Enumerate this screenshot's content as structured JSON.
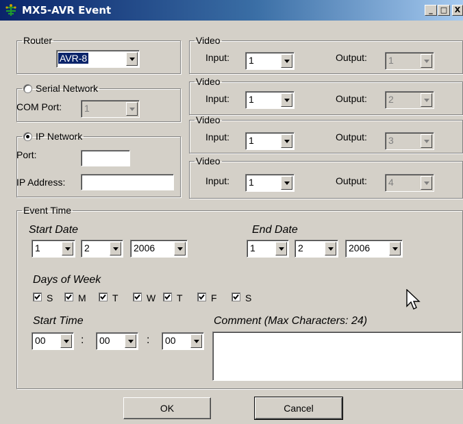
{
  "window": {
    "title": "MX5-AVR Event",
    "minimize_glyph": "_",
    "maximize_glyph": "□",
    "close_glyph": "X"
  },
  "router": {
    "legend": "Router",
    "value": "AVR-8"
  },
  "serial": {
    "legend": "Serial Network",
    "com_label": "COM Port:",
    "com_value": "1"
  },
  "ip": {
    "legend": "IP Network",
    "port_label": "Port:",
    "port_value": "",
    "address_label": "IP Address:",
    "address_value": ""
  },
  "video": [
    {
      "legend": "Video",
      "input_label": "Input:",
      "input_value": "1",
      "output_label": "Output:",
      "output_value": "1"
    },
    {
      "legend": "Video",
      "input_label": "Input:",
      "input_value": "1",
      "output_label": "Output:",
      "output_value": "2"
    },
    {
      "legend": "Video",
      "input_label": "Input:",
      "input_value": "1",
      "output_label": "Output:",
      "output_value": "3"
    },
    {
      "legend": "Video",
      "input_label": "Input:",
      "input_value": "1",
      "output_label": "Output:",
      "output_value": "4"
    }
  ],
  "event": {
    "legend": "Event Time",
    "start_date_label": "Start Date",
    "start_date": {
      "month": "1",
      "day": "2",
      "year": "2006"
    },
    "end_date_label": "End Date",
    "end_date": {
      "month": "1",
      "day": "2",
      "year": "2006"
    },
    "days_label": "Days of  Week",
    "days": [
      {
        "label": "S",
        "checked": true
      },
      {
        "label": "M",
        "checked": true
      },
      {
        "label": "T",
        "checked": true
      },
      {
        "label": "W",
        "checked": true
      },
      {
        "label": "T",
        "checked": true
      },
      {
        "label": "F",
        "checked": true
      },
      {
        "label": "S",
        "checked": true
      }
    ],
    "start_time_label": "Start Time",
    "time": {
      "hour": "00",
      "minute": "00",
      "second": "00",
      "separator": ":"
    },
    "comment_label": "Comment (Max Characters: 24)",
    "comment_value": ""
  },
  "buttons": {
    "ok": "OK",
    "cancel": "Cancel"
  },
  "icons": {
    "app": "network-tree-icon",
    "cursor": "mouse-pointer-icon"
  },
  "colors": {
    "title_start": "#0a246a",
    "title_end": "#a6caf0",
    "face": "#d4d0c8",
    "selection": "#0a246a"
  }
}
